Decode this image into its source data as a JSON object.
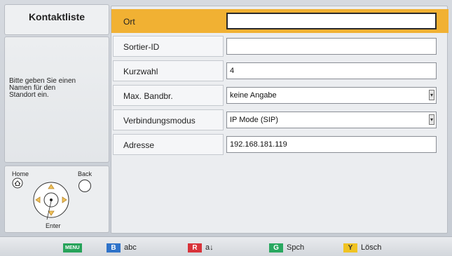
{
  "sidebar": {
    "title": "Kontaktliste",
    "help_lines": [
      "Bitte geben Sie einen",
      "Namen für den",
      "Standort ein."
    ],
    "remote": {
      "home_label": "Home",
      "back_label": "Back",
      "enter_label": "Enter"
    }
  },
  "form": {
    "rows": [
      {
        "label": "Ort",
        "value": ""
      },
      {
        "label": "Sortier-ID",
        "value": ""
      },
      {
        "label": "Kurzwahl",
        "value": "4"
      },
      {
        "label": "Max. Bandbr.",
        "value": "keine Angabe"
      },
      {
        "label": "Verbindungsmodus",
        "value": "IP Mode (SIP)"
      },
      {
        "label": "Adresse",
        "value": "192.168.181.119"
      }
    ]
  },
  "bottom_bar": {
    "menu": {
      "chip": "MENU",
      "color": "#27a35a"
    },
    "b": {
      "chip": "B",
      "text": "abc",
      "color": "#2f73c9"
    },
    "r": {
      "chip": "R",
      "text": "a↓",
      "color": "#d8333a"
    },
    "g": {
      "chip": "G",
      "text": "Spch",
      "color": "#29a860"
    },
    "y": {
      "chip": "Y",
      "text": "Lösch",
      "color": "#f0c322"
    }
  },
  "colors": {
    "selected_row": "#f1b133"
  },
  "icons": {
    "dropdown": "dropdown-arrow-icon",
    "home": "home-icon",
    "dpad": "directional-pad-icon",
    "back": "back-button-icon"
  }
}
